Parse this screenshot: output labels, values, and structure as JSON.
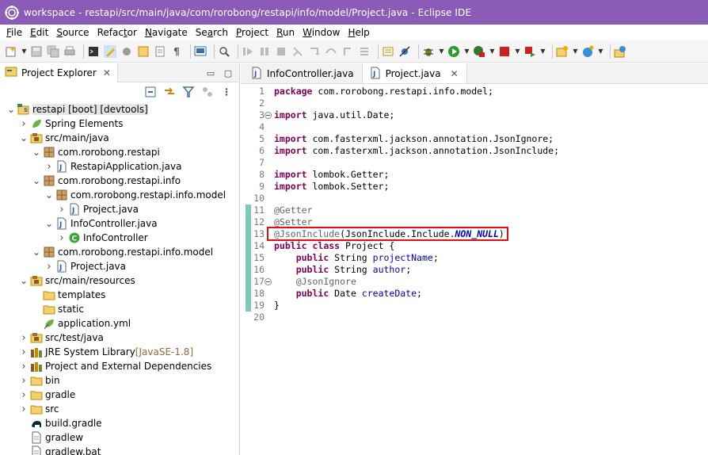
{
  "window": {
    "title": "workspace - restapi/src/main/java/com/rorobong/restapi/info/model/Project.java - Eclipse IDE",
    "accent": "#8a5cb8"
  },
  "menu": [
    {
      "label": "File",
      "u": "F",
      "rest": "ile"
    },
    {
      "label": "Edit",
      "u": "E",
      "rest": "dit"
    },
    {
      "label": "Source",
      "u": "S",
      "rest": "ource"
    },
    {
      "label": "Refactor",
      "pre": "Refac",
      "u": "t",
      "rest": "or"
    },
    {
      "label": "Navigate",
      "u": "N",
      "rest": "avigate"
    },
    {
      "label": "Search",
      "pre": "Se",
      "u": "a",
      "rest": "rch"
    },
    {
      "label": "Project",
      "u": "P",
      "rest": "roject"
    },
    {
      "label": "Run",
      "u": "R",
      "rest": "un"
    },
    {
      "label": "Window",
      "u": "W",
      "rest": "indow"
    },
    {
      "label": "Help",
      "u": "H",
      "rest": "elp"
    }
  ],
  "explorer": {
    "tab_label": "Project Explorer",
    "tree": [
      {
        "depth": 0,
        "arrow": "expanded",
        "icon": "project-icon",
        "label": "restapi [boot] [devtools]",
        "selected": true
      },
      {
        "depth": 1,
        "arrow": "collapsed",
        "icon": "spring-icon",
        "label": "Spring Elements"
      },
      {
        "depth": 1,
        "arrow": "expanded",
        "icon": "source-folder-icon",
        "label": "src/main/java"
      },
      {
        "depth": 2,
        "arrow": "expanded",
        "icon": "package-icon",
        "label": "com.rorobong.restapi"
      },
      {
        "depth": 3,
        "arrow": "collapsed",
        "icon": "java-file-icon",
        "label": "RestapiApplication.java"
      },
      {
        "depth": 2,
        "arrow": "expanded",
        "icon": "package-icon",
        "label": "com.rorobong.restapi.info"
      },
      {
        "depth": 3,
        "arrow": "expanded",
        "icon": "package-icon",
        "label": "com.rorobong.restapi.info.model"
      },
      {
        "depth": 4,
        "arrow": "collapsed",
        "icon": "java-file-icon",
        "label": "Project.java"
      },
      {
        "depth": 3,
        "arrow": "expanded",
        "icon": "java-file-icon",
        "label": "InfoController.java"
      },
      {
        "depth": 4,
        "arrow": "collapsed",
        "icon": "class-icon",
        "label": "InfoController"
      },
      {
        "depth": 2,
        "arrow": "expanded",
        "icon": "package-icon",
        "label": "com.rorobong.restapi.info.model"
      },
      {
        "depth": 3,
        "arrow": "collapsed",
        "icon": "java-file-icon",
        "label": "Project.java"
      },
      {
        "depth": 1,
        "arrow": "expanded",
        "icon": "source-folder-icon",
        "label": "src/main/resources"
      },
      {
        "depth": 2,
        "arrow": "none",
        "icon": "folder-icon",
        "label": "templates"
      },
      {
        "depth": 2,
        "arrow": "none",
        "icon": "folder-icon",
        "label": "static"
      },
      {
        "depth": 2,
        "arrow": "none",
        "icon": "yaml-file-icon",
        "label": "application.yml"
      },
      {
        "depth": 1,
        "arrow": "collapsed",
        "icon": "source-folder-icon",
        "label": "src/test/java"
      },
      {
        "depth": 1,
        "arrow": "collapsed",
        "icon": "library-icon",
        "label": "JRE System Library",
        "decor": "[JavaSE-1.8]"
      },
      {
        "depth": 1,
        "arrow": "collapsed",
        "icon": "library-icon",
        "label": "Project and External Dependencies"
      },
      {
        "depth": 1,
        "arrow": "collapsed",
        "icon": "folder-icon",
        "label": "bin"
      },
      {
        "depth": 1,
        "arrow": "collapsed",
        "icon": "folder-icon",
        "label": "gradle"
      },
      {
        "depth": 1,
        "arrow": "collapsed",
        "icon": "folder-icon",
        "label": "src"
      },
      {
        "depth": 1,
        "arrow": "none",
        "icon": "gradle-icon",
        "label": "build.gradle"
      },
      {
        "depth": 1,
        "arrow": "none",
        "icon": "file-icon",
        "label": "gradlew"
      },
      {
        "depth": 1,
        "arrow": "none",
        "icon": "file-icon",
        "label": "gradlew.bat"
      }
    ]
  },
  "editor": {
    "tabs": [
      {
        "label": "InfoController.java",
        "active": false
      },
      {
        "label": "Project.java",
        "active": true
      }
    ],
    "lines": [
      {
        "n": "1",
        "tokens": [
          [
            "kw",
            "package"
          ],
          [
            "pkg",
            " com.rorobong.restapi.info.model;"
          ]
        ]
      },
      {
        "n": "2",
        "tokens": []
      },
      {
        "n": "3",
        "fold": true,
        "tokens": [
          [
            "kw",
            "import"
          ],
          [
            "pkg",
            " java.util.Date;"
          ]
        ]
      },
      {
        "n": "4",
        "tokens": []
      },
      {
        "n": "5",
        "tokens": [
          [
            "kw",
            "import"
          ],
          [
            "pkg",
            " com.fasterxml.jackson.annotation.JsonIgnore;"
          ]
        ]
      },
      {
        "n": "6",
        "tokens": [
          [
            "kw",
            "import"
          ],
          [
            "pkg",
            " com.fasterxml.jackson.annotation.JsonInclude;"
          ]
        ]
      },
      {
        "n": "7",
        "tokens": []
      },
      {
        "n": "8",
        "tokens": [
          [
            "kw",
            "import"
          ],
          [
            "pkg",
            " lombok.Getter;"
          ]
        ]
      },
      {
        "n": "9",
        "tokens": [
          [
            "kw",
            "import"
          ],
          [
            "pkg",
            " lombok.Setter;"
          ]
        ]
      },
      {
        "n": "10",
        "tokens": []
      },
      {
        "n": "11",
        "tokens": [
          [
            "ann",
            "@Getter"
          ]
        ]
      },
      {
        "n": "12",
        "tokens": [
          [
            "ann",
            "@Setter"
          ]
        ]
      },
      {
        "n": "13",
        "tokens": [
          [
            "ann",
            "@JsonInclude"
          ],
          [
            "pkg",
            "(JsonInclude.Include."
          ],
          [
            "cst",
            "NON_NULL"
          ],
          [
            "pkg",
            ")"
          ]
        ]
      },
      {
        "n": "14",
        "tokens": [
          [
            "kw",
            "public"
          ],
          [
            "pkg",
            " "
          ],
          [
            "kw",
            "class"
          ],
          [
            "pkg",
            " Project {"
          ]
        ]
      },
      {
        "n": "15",
        "tokens": [
          [
            "pkg",
            "    "
          ],
          [
            "kw",
            "public"
          ],
          [
            "pkg",
            " String "
          ],
          [
            "fld",
            "projectName"
          ],
          [
            "pkg",
            ";"
          ]
        ]
      },
      {
        "n": "16",
        "tokens": [
          [
            "pkg",
            "    "
          ],
          [
            "kw",
            "public"
          ],
          [
            "pkg",
            " String "
          ],
          [
            "fld",
            "author"
          ],
          [
            "pkg",
            ";"
          ]
        ]
      },
      {
        "n": "17",
        "fold": true,
        "tokens": [
          [
            "pkg",
            "    "
          ],
          [
            "ann",
            "@JsonIgnore"
          ]
        ]
      },
      {
        "n": "18",
        "tokens": [
          [
            "pkg",
            "    "
          ],
          [
            "kw",
            "public"
          ],
          [
            "pkg",
            " Date "
          ],
          [
            "fld",
            "createDate"
          ],
          [
            "pkg",
            ";"
          ]
        ]
      },
      {
        "n": "19",
        "tokens": [
          [
            "pkg",
            "}"
          ]
        ]
      },
      {
        "n": "20",
        "tokens": []
      }
    ],
    "highlight_color": "#e01010",
    "change_bar_color": "#7fc7b8"
  }
}
